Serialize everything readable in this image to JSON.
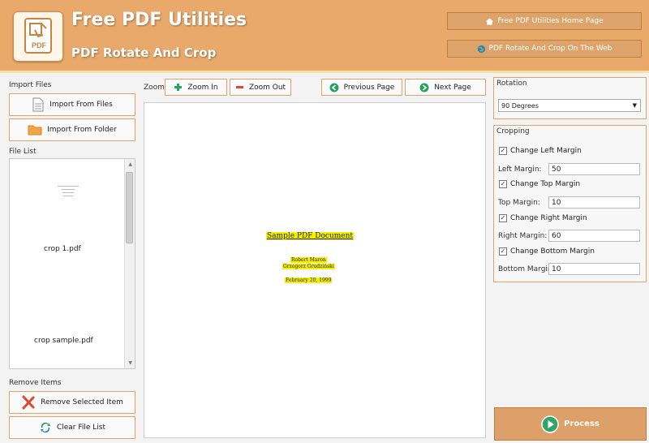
{
  "header": {
    "title": "Free PDF Utilities",
    "subtitle": "PDF Rotate And Crop",
    "home_link": "Free PDF Utilities Home Page",
    "web_link": "PDF Rotate And Crop On The Web"
  },
  "import": {
    "label": "Import Files",
    "from_files": "Import From Files",
    "from_folder": "Import From Folder"
  },
  "file_list": {
    "label": "File List",
    "items": [
      "crop 1.pdf",
      "crop sample.pdf"
    ]
  },
  "remove": {
    "label": "Remove Items",
    "remove_selected": "Remove Selected Item",
    "clear_list": "Clear File List"
  },
  "toolbar": {
    "zoom_label": "Zoom:",
    "zoom_in": "Zoom In",
    "zoom_out": "Zoom Out",
    "prev_page": "Previous Page",
    "next_page": "Next Page"
  },
  "preview": {
    "doc_title": "Sample PDF Document",
    "line1": "Robert Maron",
    "line2": "Grzegorz Grudziński",
    "line3": "February 20, 1999"
  },
  "rotation": {
    "label": "Rotation",
    "selected": "90 Degrees"
  },
  "cropping": {
    "label": "Cropping",
    "left": {
      "check": "Change Left Margin",
      "label": "Left Margin:",
      "value": "50",
      "checked": true
    },
    "top": {
      "check": "Change Top Margin",
      "label": "Top Margin:",
      "value": "10",
      "checked": true
    },
    "right": {
      "check": "Change Right Margin",
      "label": "Right Margin:",
      "value": "60",
      "checked": true
    },
    "bottom": {
      "check": "Change Bottom Margin",
      "label": "Bottom Margin:",
      "value": "10",
      "checked": true
    }
  },
  "process_label": "Process",
  "colors": {
    "header": "#e9a96b",
    "accent_border": "#e3a366",
    "highlight": "#f4f000",
    "play_green": "#2fa56a"
  }
}
